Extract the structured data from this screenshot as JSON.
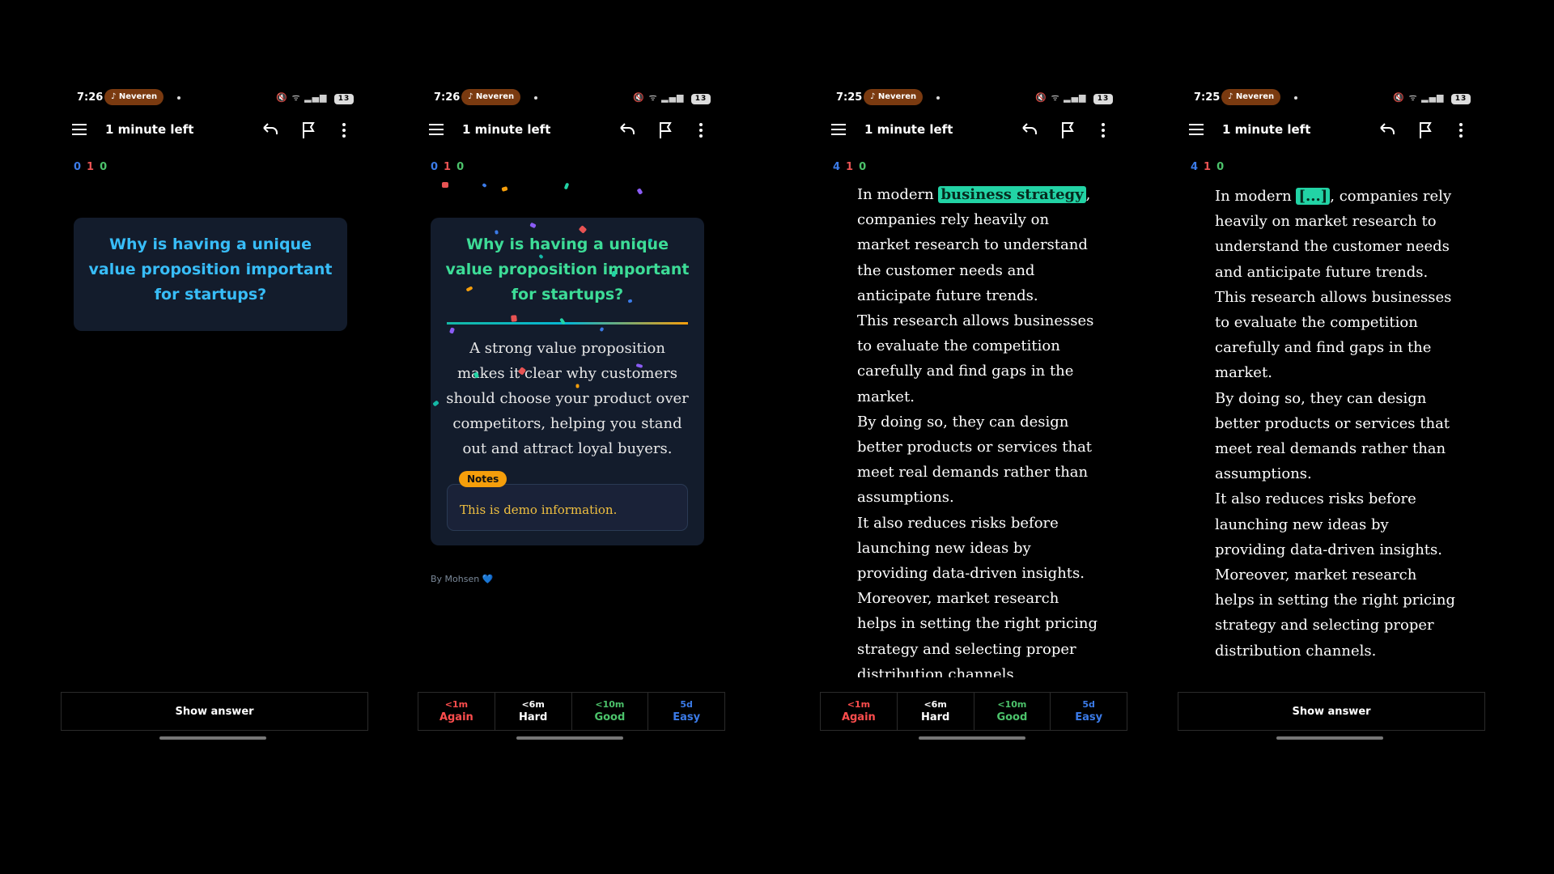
{
  "status": {
    "time_a": "7:26",
    "time_b": "7:25",
    "app_pill": "♪ Neveren",
    "battery": "13"
  },
  "toolbar": {
    "title": "1 minute left"
  },
  "counts": {
    "s1": [
      "0",
      "1",
      "0"
    ],
    "s3": [
      "4",
      "1",
      "0"
    ]
  },
  "card": {
    "question": "Why is having a unique value proposition important for startups?",
    "answer": "A strong value proposition makes it clear why customers should choose your product over competitors, helping you stand out and attract loyal buyers.",
    "notes_label": "Notes",
    "notes_text": "This is demo information.",
    "byline": "By Mohsen 💙"
  },
  "reading": {
    "lead": "In modern ",
    "highlight": "business strategy",
    "cloze": "[...]",
    "after_first": ", companies rely heavily on market research to understand the customer needs and anticipate future trends.",
    "p2": "This research allows businesses to evaluate the competition carefully and find gaps in the market.",
    "p3": "By doing so, they can design better products or services that meet real demands rather than assumptions.",
    "p4": "It also reduces risks before launching new ideas by providing data-driven insights.",
    "p5": "Moreover, market research helps in setting the right pricing strategy and selecting proper distribution channels."
  },
  "buttons": {
    "show_answer": "Show answer",
    "again": {
      "interval": "<1m",
      "label": "Again"
    },
    "hard": {
      "interval": "<6m",
      "label": "Hard"
    },
    "good": {
      "interval": "<10m",
      "label": "Good"
    },
    "easy": {
      "interval": "5d",
      "label": "Easy"
    }
  },
  "colors": {
    "question": "#38bdf8",
    "highlight": "#22d3a5",
    "notes_badge": "#f59e0b",
    "card_bg": "#131c2c"
  }
}
